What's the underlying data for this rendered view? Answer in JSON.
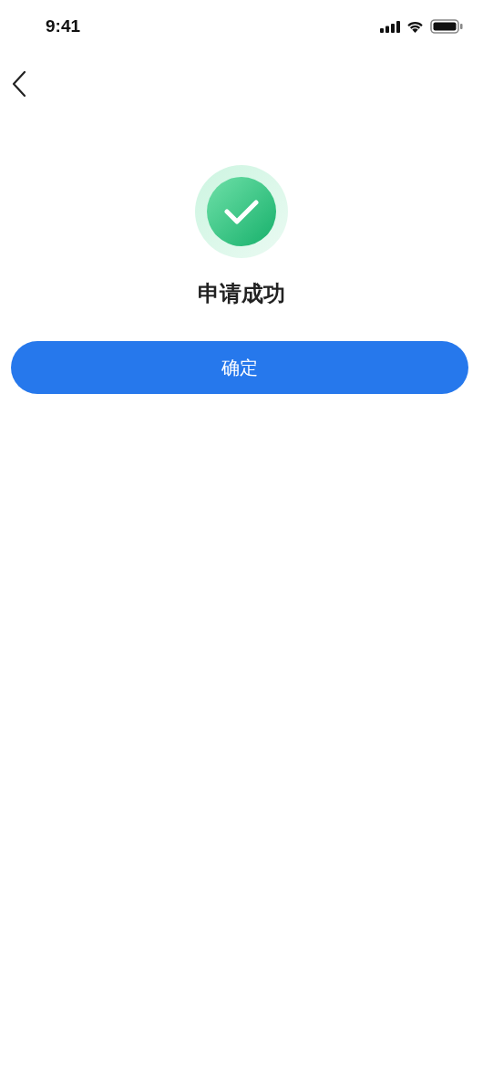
{
  "status_bar": {
    "time": "9:41"
  },
  "result": {
    "kind": "success",
    "title": "申请成功"
  },
  "buttons": [
    {
      "label": "确定"
    }
  ]
}
